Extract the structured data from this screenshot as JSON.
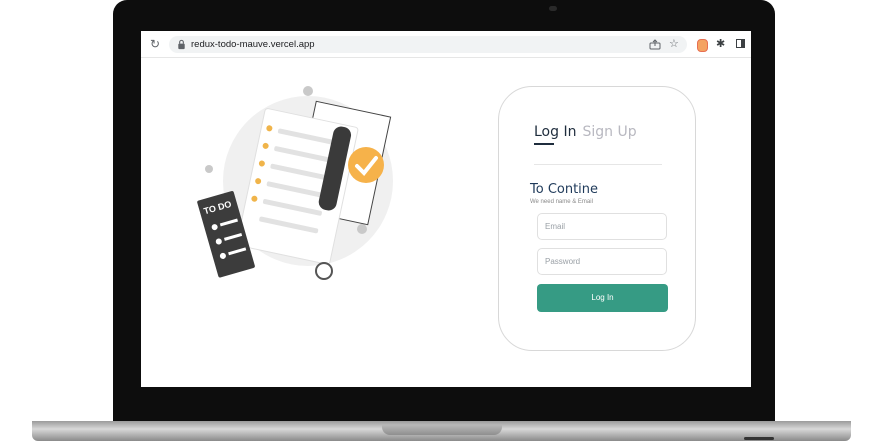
{
  "browser": {
    "url": "redux-todo-mauve.vercel.app"
  },
  "auth": {
    "tab_login": "Log In",
    "tab_signup": "Sign Up",
    "heading": "To Contine",
    "subheading": "We need name & Email",
    "email_placeholder": "Email",
    "password_placeholder": "Password",
    "submit_label": "Log In"
  },
  "illustration": {
    "label": "TO DO"
  },
  "colors": {
    "primary_button": "#369b84",
    "heading": "#1f3a5a",
    "accent_check": "#f6b24a"
  }
}
